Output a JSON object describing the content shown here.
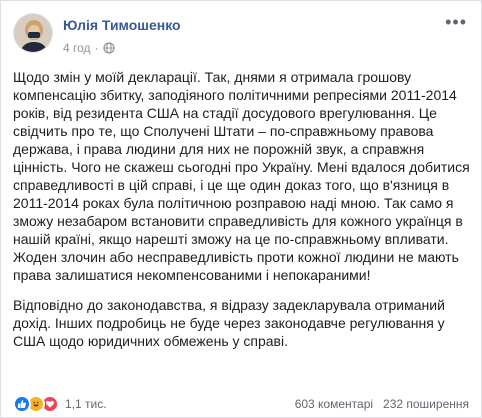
{
  "post": {
    "author": "Юлія Тимошенко",
    "time": "4 год",
    "paragraphs": [
      "Щодо змін у моїй декларації. Так, днями я отримала грошову компенсацію збитку, заподіяного політичними репресіями 2011-2014 років, від резидента США на стадії досудового врегулювання. Це свідчить про те, що Сполучені Штати – по-справжньому правова держава, і права людини для них не порожній звук, а справжня цінність. Чого не скажеш сьогодні про Україну. Мені вдалося добитися справедливості в цій справі, і це ще один доказ того, що в'язниця в 2011-2014 роках була політичною розправою наді мною. Так само я зможу незабаром встановити справедливість для кожного українця в нашій країні, якщо нарешті зможу на це по-справжньому впливати. Жоден злочин або несправедливість проти кожної людини не мають права залишатися некомпенсованими і непокараними!",
      "Відповідно до законодавства, я відразу задекларувала отриманий дохід. Інших подробиць не буде через законодавче регулювання у США щодо юридичних обмежень у справі."
    ]
  },
  "footer": {
    "reactions": [
      "like",
      "haha",
      "love"
    ],
    "reaction_count": "1,1 тис.",
    "comments": "603 коментарі",
    "shares": "232 поширення"
  },
  "colors": {
    "author": "#385898",
    "like": "#1877f2",
    "haha": "#f7b125",
    "love": "#f33e58"
  }
}
